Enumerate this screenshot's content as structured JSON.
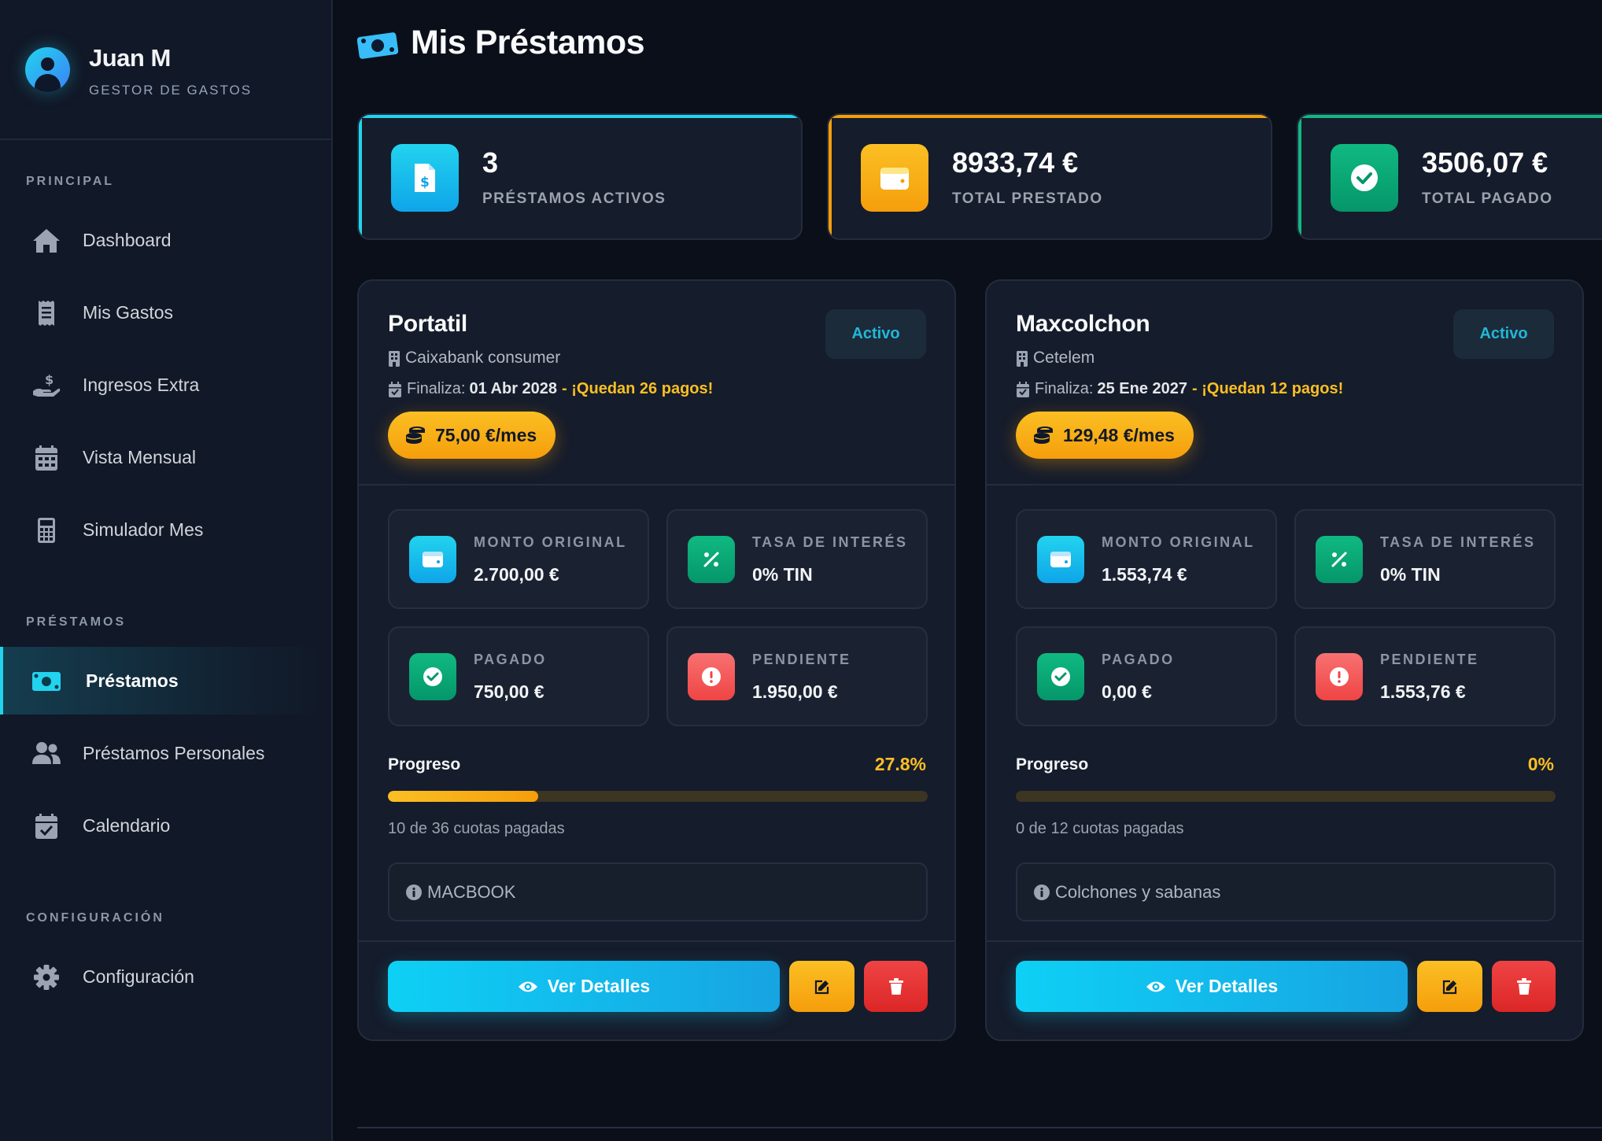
{
  "user": {
    "name": "Juan M",
    "role": "GESTOR DE GASTOS"
  },
  "sidebar": {
    "sections": [
      {
        "title": "PRINCIPAL",
        "items": [
          {
            "label": "Dashboard",
            "icon": "home-icon"
          },
          {
            "label": "Mis Gastos",
            "icon": "receipt-icon"
          },
          {
            "label": "Ingresos Extra",
            "icon": "hand-holding-dollar-icon"
          },
          {
            "label": "Vista Mensual",
            "icon": "calendar-grid-icon"
          },
          {
            "label": "Simulador Mes",
            "icon": "calculator-icon"
          }
        ]
      },
      {
        "title": "PRÉSTAMOS",
        "items": [
          {
            "label": "Préstamos",
            "icon": "money-bill-icon",
            "active": true
          },
          {
            "label": "Préstamos Personales",
            "icon": "users-icon"
          },
          {
            "label": "Calendario",
            "icon": "calendar-check-icon"
          }
        ]
      },
      {
        "title": "CONFIGURACIÓN",
        "items": [
          {
            "label": "Configuración",
            "icon": "gear-icon"
          }
        ]
      }
    ]
  },
  "page": {
    "title": "Mis Préstamos",
    "icon": "money-bill-icon"
  },
  "stats": [
    {
      "value": "3",
      "label": "PRÉSTAMOS ACTIVOS",
      "icon": "invoice-dollar-icon",
      "color": "#0ea5e9"
    },
    {
      "value": "8933,74 €",
      "label": "TOTAL PRESTADO",
      "icon": "wallet-icon",
      "color": "#f59e0b"
    },
    {
      "value": "3506,07 €",
      "label": "TOTAL PAGADO",
      "icon": "check-circle-icon",
      "color": "#10b981"
    }
  ],
  "loans": [
    {
      "name": "Portatil",
      "status": "Activo",
      "lender": "Caixabank consumer",
      "end_prefix": "Finaliza:",
      "end_date": "01 Abr 2028",
      "remaining": "- ¡Quedan 26 pagos!",
      "monthly": "75,00 €/mes",
      "original_label": "MONTO ORIGINAL",
      "original_value": "2.700,00 €",
      "rate_label": "TASA DE INTERÉS",
      "rate_value": "0% TIN",
      "paid_label": "PAGADO",
      "paid_value": "750,00 €",
      "pending_label": "PENDIENTE",
      "pending_value": "1.950,00 €",
      "progress_label": "Progreso",
      "progress_pct": "27.8%",
      "progress_fraction": 0.278,
      "installments": "10 de 36 cuotas pagadas",
      "note": "MACBOOK",
      "details_label": "Ver Detalles"
    },
    {
      "name": "Maxcolchon",
      "status": "Activo",
      "lender": "Cetelem",
      "end_prefix": "Finaliza:",
      "end_date": "25 Ene 2027",
      "remaining": "- ¡Quedan 12 pagos!",
      "monthly": "129,48 €/mes",
      "original_label": "MONTO ORIGINAL",
      "original_value": "1.553,74 €",
      "rate_label": "TASA DE INTERÉS",
      "rate_value": "0% TIN",
      "paid_label": "PAGADO",
      "paid_value": "0,00 €",
      "pending_label": "PENDIENTE",
      "pending_value": "1.553,76 €",
      "progress_label": "Progreso",
      "progress_pct": "0%",
      "progress_fraction": 0,
      "installments": "0 de 12 cuotas pagadas",
      "note": "Colchones y sabanas",
      "details_label": "Ver Detalles"
    }
  ],
  "colors": {
    "accent_cyan": "#22d3ee",
    "accent_amber": "#fbbf24",
    "accent_green": "#10b981",
    "accent_red": "#ef4444",
    "background": "#0b0f19",
    "card": "#151c2b"
  }
}
